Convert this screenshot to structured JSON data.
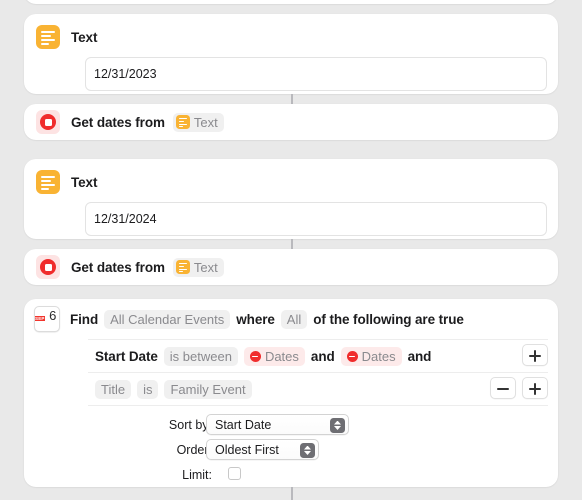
{
  "app": {
    "background_color": "#e9e9e9",
    "card_color": "#ffffff"
  },
  "actions": [
    {
      "id": "text-1",
      "type": "text-action",
      "icon": "text-app-icon",
      "title": "Text",
      "value": "12/31/2023"
    },
    {
      "id": "get-dates-1",
      "type": "get-dates-action",
      "icon": "dates-app-icon",
      "title": "Get dates from",
      "input_token": {
        "icon": "text-app-mini-icon",
        "label": "Text"
      }
    },
    {
      "id": "text-2",
      "type": "text-action",
      "icon": "text-app-icon",
      "title": "Text",
      "value": "12/31/2024"
    },
    {
      "id": "get-dates-2",
      "type": "get-dates-action",
      "icon": "dates-app-icon",
      "title": "Get dates from",
      "input_token": {
        "icon": "text-app-mini-icon",
        "label": "Text"
      }
    }
  ],
  "find_action": {
    "icon": {
      "name": "calendar-icon",
      "month": "SEP",
      "day": "6",
      "header_color": "#f2342c"
    },
    "header": {
      "find_label": "Find",
      "content_type": "All Calendar Events",
      "where_label": "where",
      "match_mode": "All",
      "suffix_label": "of the following are true"
    },
    "filters": [
      {
        "property": "Start Date",
        "operator": "is between",
        "value_a": "Dates",
        "conjunction_mid": "and",
        "value_b": "Dates",
        "conjunction_end": "and",
        "has_remove": false,
        "has_add": true
      },
      {
        "property": "Title",
        "operator": "is",
        "value": "Family Event",
        "has_remove": true,
        "has_add": true
      }
    ],
    "options": {
      "sort_by_label": "Sort by:",
      "sort_by_value": "Start Date",
      "order_label": "Order:",
      "order_value": "Oldest First",
      "limit_label": "Limit:",
      "limit_checked": false
    }
  }
}
